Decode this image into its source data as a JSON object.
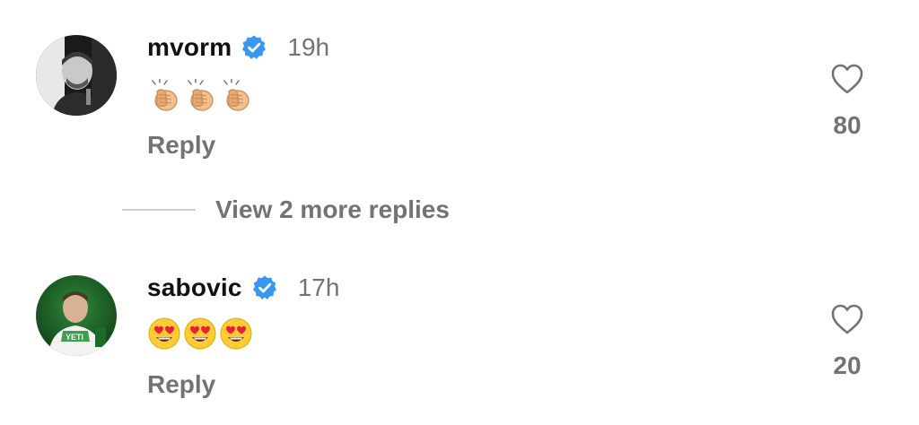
{
  "comments": [
    {
      "username": "mvorm",
      "verified": true,
      "timestamp": "19h",
      "emoji": [
        "clapping-hands",
        "clapping-hands",
        "clapping-hands"
      ],
      "reply_label": "Reply",
      "likes": "80"
    },
    {
      "username": "sabovic",
      "verified": true,
      "timestamp": "17h",
      "emoji": [
        "heart-eyes-face",
        "heart-eyes-face",
        "heart-eyes-face"
      ],
      "reply_label": "Reply",
      "likes": "20"
    }
  ],
  "more_replies_label": "View 2 more replies",
  "colors": {
    "verified_blue": "#3897f0",
    "secondary_text": "#737373",
    "primary_text": "#111111",
    "divider": "#cfcfcf"
  }
}
